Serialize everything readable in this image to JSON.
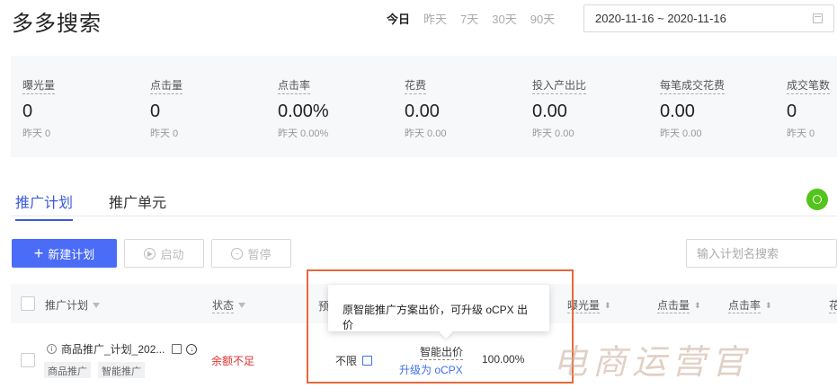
{
  "page": {
    "title": "多多搜索"
  },
  "date_tabs": [
    "今日",
    "昨天",
    "7天",
    "30天",
    "90天"
  ],
  "date_range": "2020-11-16 ~ 2020-11-16",
  "stats": [
    {
      "label": "曝光量",
      "value": "0",
      "yesterday": "昨天 0"
    },
    {
      "label": "点击量",
      "value": "0",
      "yesterday": "昨天 0"
    },
    {
      "label": "点击率",
      "value": "0.00%",
      "yesterday": "昨天 0.00%"
    },
    {
      "label": "花费",
      "value": "0.00",
      "yesterday": "昨天 0.00"
    },
    {
      "label": "投入产出比",
      "value": "0.00",
      "yesterday": "昨天 0.00"
    },
    {
      "label": "每笔成交花费",
      "value": "0.00",
      "yesterday": "昨天 0.00"
    },
    {
      "label": "成交笔数",
      "value": "0",
      "yesterday": "昨天 0"
    }
  ],
  "tabs": [
    "推广计划",
    "推广单元"
  ],
  "toolbar": {
    "new_plan": "新建计划",
    "start": "启动",
    "pause": "暂停"
  },
  "search": {
    "placeholder": "输入计划名搜索"
  },
  "table": {
    "headers": [
      "推广计划",
      "状态",
      "预",
      "曝光量",
      "点击量",
      "点击率",
      "花"
    ],
    "row": {
      "name": "商品推广_计划_202...",
      "tags": [
        "商品推广",
        "智能推广"
      ],
      "status": "余额不足",
      "budget": "不限",
      "bid": "智能出价",
      "upgrade_link": "升级为 oCPX",
      "percent": "100.00%"
    }
  },
  "tooltip": "原智能推广方案出价，可升级 oCPX 出价",
  "watermark": "电商运营官",
  "colors": {
    "accent": "#4a6cf7",
    "danger": "#e03131",
    "highlight_border": "#e8693c"
  }
}
